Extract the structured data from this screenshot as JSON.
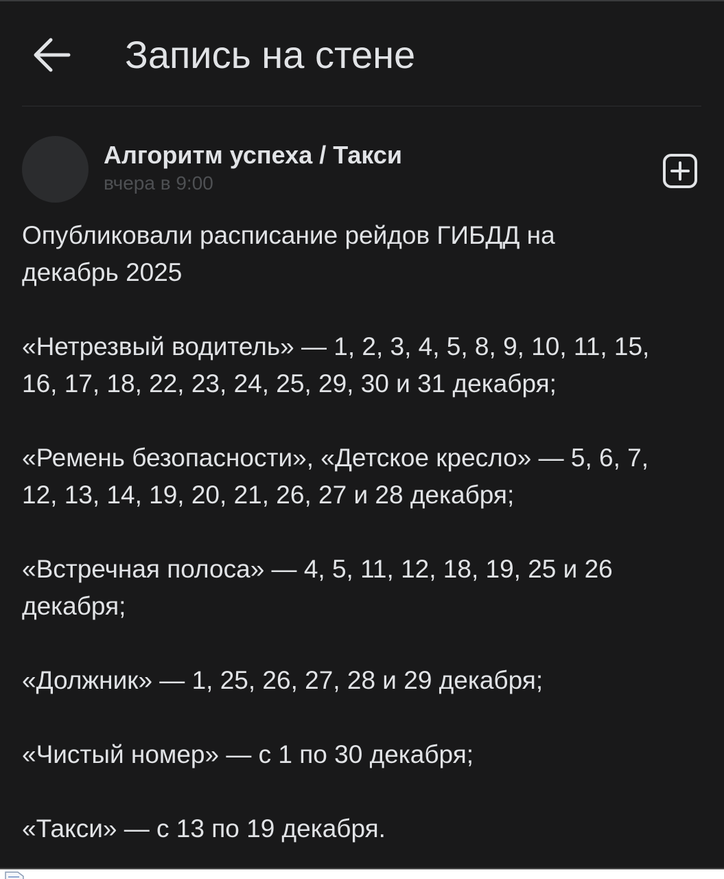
{
  "header": {
    "title": "Запись на стене",
    "back_icon": "arrow-left-icon"
  },
  "post": {
    "author": "Алгоритм успеха / Такси",
    "time": "вчера в 9:00",
    "add_icon": "plus-square-icon",
    "paragraphs": [
      {
        "lines": [
          "Опубликовали расписание рейдов ГИБДД на",
          "декабрь 2025"
        ]
      },
      {
        "lines": [
          "«Нетрезвый водитель» — 1, 2, 3, 4, 5, 8, 9, 10, 11, 15,",
          "16, 17, 18, 22, 23, 24, 25, 29, 30 и 31 декабря;"
        ]
      },
      {
        "lines": [
          "«Ремень безопасности», «Детское кресло» — 5, 6, 7,",
          "12, 13, 14, 19, 20, 21, 26, 27 и 28 декабря;"
        ]
      },
      {
        "lines": [
          "«Встречная полоса» — 4, 5, 11, 12, 18, 19, 25 и 26",
          "декабря;"
        ]
      },
      {
        "lines": [
          "«Должник» — 1, 25, 26, 27, 28 и 29 декабря;"
        ]
      },
      {
        "lines": [
          "«Чистый номер» — с 1 по 30 декабря;"
        ]
      },
      {
        "lines": [
          "«Такси» — с 13 по 19 декабря."
        ]
      }
    ]
  },
  "colors": {
    "background": "#19191a",
    "text_primary": "#e1e3e6",
    "text_secondary": "#4e5053",
    "avatar_placeholder": "#2b2c2e"
  }
}
